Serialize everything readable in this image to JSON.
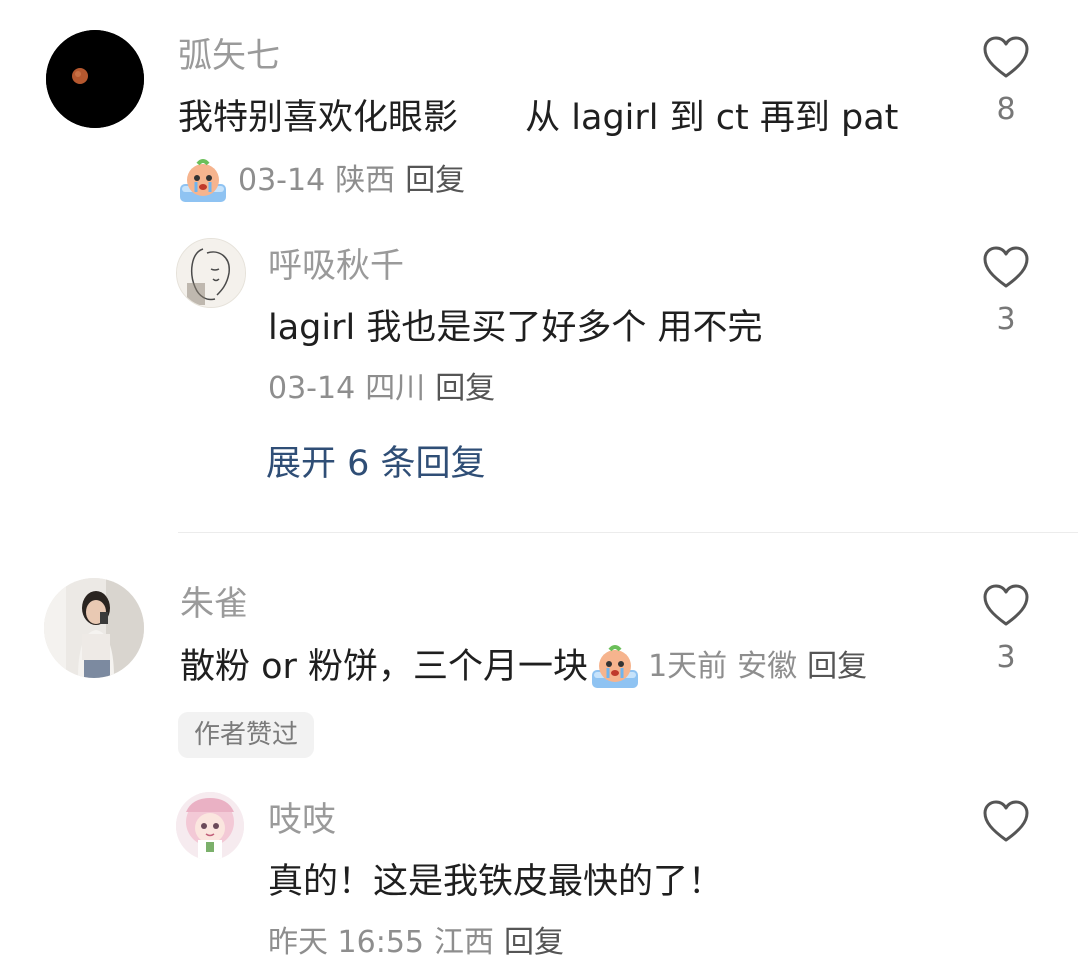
{
  "comments": [
    {
      "username": "弧矢七",
      "text_part1": "我特别喜欢化眼影",
      "text_part2": "从 lagirl 到 ct 再到 pat",
      "emoji": "crying-face-emoji",
      "date": "03-14",
      "location": "陕西",
      "reply_label": "回复",
      "likes": "8",
      "replies": [
        {
          "username": "呼吸秋千",
          "text": "lagirl 我也是买了好多个 用不完",
          "date": "03-14",
          "location": "四川",
          "reply_label": "回复",
          "likes": "3"
        }
      ],
      "expand_label": "展开 6 条回复"
    },
    {
      "username": "朱雀",
      "text": "散粉 or 粉饼，三个月一块",
      "emoji": "crying-face-emoji",
      "date": "1天前",
      "location": "安徽",
      "reply_label": "回复",
      "likes": "3",
      "author_badge": "作者赞过",
      "replies": [
        {
          "username": "吱吱",
          "text": "真的！这是我铁皮最快的了！",
          "date": "昨天 16:55",
          "location": "江西",
          "reply_label": "回复",
          "likes": ""
        }
      ]
    }
  ],
  "colors": {
    "username": "#9a9a9a",
    "text": "#1f1f1f",
    "meta": "#8e8e8e",
    "link": "#2f4e76",
    "divider": "#ececec"
  }
}
